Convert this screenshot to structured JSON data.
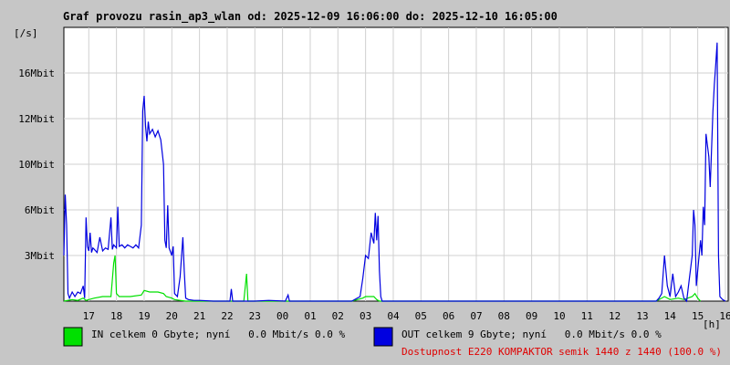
{
  "chart_data": {
    "type": "line",
    "title": "Graf provozu rasin_ap3_wlan od: 2025-12-09 16:06:00 do: 2025-12-10 16:05:00",
    "ylabel": "[/s]",
    "xlabel": "[h]",
    "ylim": [
      0,
      18.0
    ],
    "xlim": [
      16.1,
      16.1
    ],
    "grid": true,
    "y_ticks": [
      {
        "value": 3,
        "label": "3Mbit"
      },
      {
        "value": 6,
        "label": "6Mbit"
      },
      {
        "value": 9,
        "label": "10Mbit"
      },
      {
        "value": 12,
        "label": "12Mbit"
      },
      {
        "value": 15,
        "label": "16Mbit"
      }
    ],
    "x_ticks": [
      "17",
      "18",
      "19",
      "20",
      "21",
      "22",
      "23",
      "00",
      "01",
      "02",
      "03",
      "04",
      "05",
      "06",
      "07",
      "08",
      "09",
      "10",
      "11",
      "12",
      "13",
      "14",
      "15",
      "16"
    ],
    "series": [
      {
        "name": "IN celkem 0 Gbyte; nyní 0.0 Mbit/s 0.0 %",
        "color": "#00e000",
        "points": [
          [
            16.1,
            0.0
          ],
          [
            16.4,
            0.1
          ],
          [
            16.6,
            0.05
          ],
          [
            16.8,
            0.2
          ],
          [
            16.9,
            0.05
          ],
          [
            17.0,
            0.1
          ],
          [
            17.2,
            0.2
          ],
          [
            17.5,
            0.3
          ],
          [
            17.8,
            0.3
          ],
          [
            17.9,
            2.5
          ],
          [
            17.95,
            3.0
          ],
          [
            18.0,
            0.5
          ],
          [
            18.1,
            0.3
          ],
          [
            18.5,
            0.3
          ],
          [
            18.9,
            0.4
          ],
          [
            19.0,
            0.7
          ],
          [
            19.2,
            0.6
          ],
          [
            19.5,
            0.6
          ],
          [
            19.7,
            0.5
          ],
          [
            19.8,
            0.3
          ],
          [
            20.0,
            0.2
          ],
          [
            20.1,
            0.1
          ],
          [
            20.3,
            0.05
          ],
          [
            20.5,
            0.0
          ],
          [
            21.5,
            0.0
          ],
          [
            22.0,
            0.0
          ],
          [
            22.5,
            0.0
          ],
          [
            22.6,
            0.0
          ],
          [
            22.7,
            1.8
          ],
          [
            22.75,
            0.0
          ],
          [
            23.0,
            0.0
          ],
          [
            24.0,
            0.0
          ],
          [
            26.5,
            0.0
          ],
          [
            26.9,
            0.2
          ],
          [
            27.0,
            0.3
          ],
          [
            27.3,
            0.3
          ],
          [
            27.4,
            0.1
          ],
          [
            27.5,
            0.0
          ],
          [
            37.5,
            0.0
          ],
          [
            37.8,
            0.3
          ],
          [
            38.0,
            0.1
          ],
          [
            38.3,
            0.2
          ],
          [
            38.5,
            0.1
          ],
          [
            38.8,
            0.3
          ],
          [
            38.9,
            0.5
          ],
          [
            39.0,
            0.2
          ],
          [
            39.1,
            0.0
          ]
        ]
      },
      {
        "name": "OUT celkem 9 Gbyte; nyní 0.0 Mbit/s 0.0 %",
        "color": "#0000e0",
        "points": [
          [
            16.1,
            3.0
          ],
          [
            16.15,
            7.0
          ],
          [
            16.2,
            5.0
          ],
          [
            16.25,
            0.5
          ],
          [
            16.3,
            0.2
          ],
          [
            16.4,
            0.6
          ],
          [
            16.5,
            0.3
          ],
          [
            16.6,
            0.6
          ],
          [
            16.7,
            0.5
          ],
          [
            16.8,
            1.0
          ],
          [
            16.85,
            0.2
          ],
          [
            16.9,
            5.5
          ],
          [
            16.95,
            3.6
          ],
          [
            17.0,
            3.3
          ],
          [
            17.05,
            4.5
          ],
          [
            17.1,
            3.2
          ],
          [
            17.15,
            3.5
          ],
          [
            17.2,
            3.4
          ],
          [
            17.3,
            3.2
          ],
          [
            17.4,
            4.2
          ],
          [
            17.5,
            3.3
          ],
          [
            17.6,
            3.5
          ],
          [
            17.7,
            3.4
          ],
          [
            17.8,
            5.5
          ],
          [
            17.85,
            3.4
          ],
          [
            17.9,
            3.7
          ],
          [
            18.0,
            3.5
          ],
          [
            18.05,
            6.2
          ],
          [
            18.1,
            3.6
          ],
          [
            18.2,
            3.7
          ],
          [
            18.3,
            3.5
          ],
          [
            18.4,
            3.7
          ],
          [
            18.5,
            3.6
          ],
          [
            18.6,
            3.5
          ],
          [
            18.7,
            3.7
          ],
          [
            18.8,
            3.5
          ],
          [
            18.9,
            5.0
          ],
          [
            18.95,
            12.5
          ],
          [
            19.0,
            13.5
          ],
          [
            19.05,
            11.5
          ],
          [
            19.1,
            10.5
          ],
          [
            19.15,
            11.8
          ],
          [
            19.2,
            11.0
          ],
          [
            19.3,
            11.3
          ],
          [
            19.4,
            10.8
          ],
          [
            19.5,
            11.2
          ],
          [
            19.6,
            10.6
          ],
          [
            19.7,
            9.0
          ],
          [
            19.75,
            4.0
          ],
          [
            19.8,
            3.5
          ],
          [
            19.85,
            6.3
          ],
          [
            19.9,
            3.5
          ],
          [
            20.0,
            3.0
          ],
          [
            20.05,
            3.6
          ],
          [
            20.1,
            0.5
          ],
          [
            20.2,
            0.3
          ],
          [
            20.3,
            1.6
          ],
          [
            20.4,
            4.2
          ],
          [
            20.45,
            2.0
          ],
          [
            20.5,
            0.2
          ],
          [
            20.6,
            0.1
          ],
          [
            20.8,
            0.05
          ],
          [
            21.0,
            0.05
          ],
          [
            21.5,
            0.0
          ],
          [
            22.1,
            0.0
          ],
          [
            22.15,
            0.8
          ],
          [
            22.2,
            0.0
          ],
          [
            23.0,
            0.0
          ],
          [
            23.5,
            0.05
          ],
          [
            24.1,
            0.0
          ],
          [
            24.2,
            0.4
          ],
          [
            24.25,
            0.0
          ],
          [
            26.5,
            0.0
          ],
          [
            26.8,
            0.3
          ],
          [
            26.9,
            1.5
          ],
          [
            27.0,
            3.0
          ],
          [
            27.1,
            2.8
          ],
          [
            27.2,
            4.5
          ],
          [
            27.3,
            3.8
          ],
          [
            27.35,
            5.8
          ],
          [
            27.4,
            4.0
          ],
          [
            27.45,
            5.6
          ],
          [
            27.5,
            2.0
          ],
          [
            27.55,
            0.3
          ],
          [
            27.6,
            0.0
          ],
          [
            37.5,
            0.0
          ],
          [
            37.6,
            0.2
          ],
          [
            37.7,
            0.5
          ],
          [
            37.8,
            3.0
          ],
          [
            37.9,
            1.0
          ],
          [
            38.0,
            0.3
          ],
          [
            38.1,
            1.8
          ],
          [
            38.2,
            0.3
          ],
          [
            38.3,
            0.6
          ],
          [
            38.4,
            1.0
          ],
          [
            38.5,
            0.2
          ],
          [
            38.6,
            0.0
          ],
          [
            38.7,
            1.5
          ],
          [
            38.8,
            3.0
          ],
          [
            38.85,
            6.0
          ],
          [
            38.9,
            5.0
          ],
          [
            38.95,
            1.0
          ],
          [
            39.0,
            2.0
          ],
          [
            39.1,
            4.0
          ],
          [
            39.15,
            3.0
          ],
          [
            39.2,
            6.2
          ],
          [
            39.25,
            5.0
          ],
          [
            39.3,
            11.0
          ],
          [
            39.4,
            9.5
          ],
          [
            39.45,
            7.5
          ],
          [
            39.5,
            10.0
          ],
          [
            39.55,
            12.5
          ],
          [
            39.6,
            14.2
          ],
          [
            39.65,
            15.5
          ],
          [
            39.7,
            17.0
          ],
          [
            39.75,
            3.0
          ],
          [
            39.8,
            0.3
          ],
          [
            39.9,
            0.1
          ],
          [
            40.0,
            0.0
          ]
        ]
      }
    ],
    "legend": [
      {
        "label": "IN celkem 0 Gbyte; nyní   0.0 Mbit/s 0.0 %",
        "color": "#00e000"
      },
      {
        "label": "OUT celkem 9 Gbyte; nyní   0.0 Mbit/s 0.0 %",
        "color": "#0000e0"
      }
    ],
    "footnote": "Dostupnost E220 KOMPAKTOR semik 1440 z 1440 (100.0 %)"
  }
}
